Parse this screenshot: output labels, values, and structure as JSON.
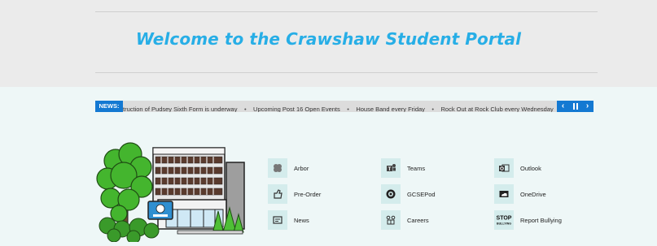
{
  "header": {
    "title": "Welcome to the Crawshaw Student Portal"
  },
  "ticker": {
    "label": "NEWS:",
    "items": [
      "truction of Pudsey Sixth Form is underway",
      "Upcoming Post 16 Open Events",
      "House Band every Friday",
      "Rock Out at Rock Club every Wednesday"
    ],
    "prev_symbol": "‹",
    "pause_symbol": "⏸",
    "next_symbol": "›"
  },
  "links": {
    "col1": [
      {
        "label": "Arbor",
        "icon": "arbor-icon"
      },
      {
        "label": "Pre-Order",
        "icon": "pre-order-icon"
      },
      {
        "label": "News",
        "icon": "news-icon"
      }
    ],
    "col2": [
      {
        "label": "Teams",
        "icon": "teams-icon"
      },
      {
        "label": "GCSEPod",
        "icon": "gcsepod-icon"
      },
      {
        "label": "Careers",
        "icon": "careers-icon"
      }
    ],
    "col3": [
      {
        "label": "Outlook",
        "icon": "outlook-icon"
      },
      {
        "label": "OneDrive",
        "icon": "onedrive-icon"
      },
      {
        "label": "Report Bullying",
        "icon": "stop-bullying-icon",
        "icon_text_top": "STOP",
        "icon_text_bottom": "BULLYING"
      }
    ]
  },
  "colors": {
    "accent": "#27aee6",
    "news_blue": "#1479d2",
    "header_bg": "#ebebeb",
    "body_bg": "#eef7f7",
    "icon_bg": "#d4ecec"
  }
}
